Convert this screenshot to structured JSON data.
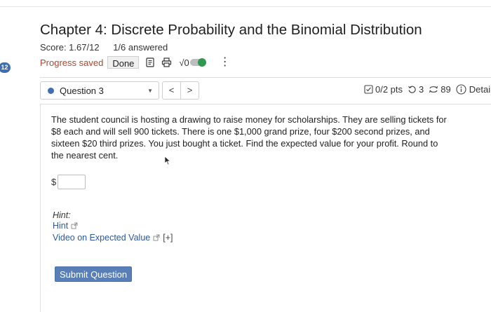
{
  "sidebar": {
    "badge": "12"
  },
  "header": {
    "title": "Chapter 4: Discrete Probability and the Binomial Distribution",
    "score": "Score: 1.67/12",
    "answered": "1/6 answered",
    "progress": "Progress saved",
    "done_label": "Done",
    "sqrt_label": "√0",
    "icons": [
      "notes-icon",
      "print-icon",
      "sqrt-icon",
      "toggle-switch",
      "kebab-menu-icon"
    ]
  },
  "nav": {
    "question_select": "Question 3",
    "prev": "<",
    "next": ">",
    "points": "0/2 pts",
    "attempts": "3",
    "submissions": "89",
    "details": "Detai"
  },
  "question": {
    "text": "The student council is hosting a drawing to raise money for scholarships. They are selling tickets for $8 each and will sell 900 tickets. There is one $1,000 grand prize, four $200 second prizes, and sixteen $20 third prizes. You just bought a ticket. Find the expected value for your profit. Round to the nearest cent.",
    "currency": "$",
    "answer_value": ""
  },
  "help": {
    "heading": "Hint:",
    "hint_link": "Hint",
    "video_link": "Video on Expected Value",
    "expand": "[+]"
  },
  "submit_label": "Submit Question",
  "colors": {
    "accent": "#3f6fb2",
    "progress": "#b0462f",
    "toggle_on": "#2f9a4e",
    "link": "#2c58a0"
  }
}
